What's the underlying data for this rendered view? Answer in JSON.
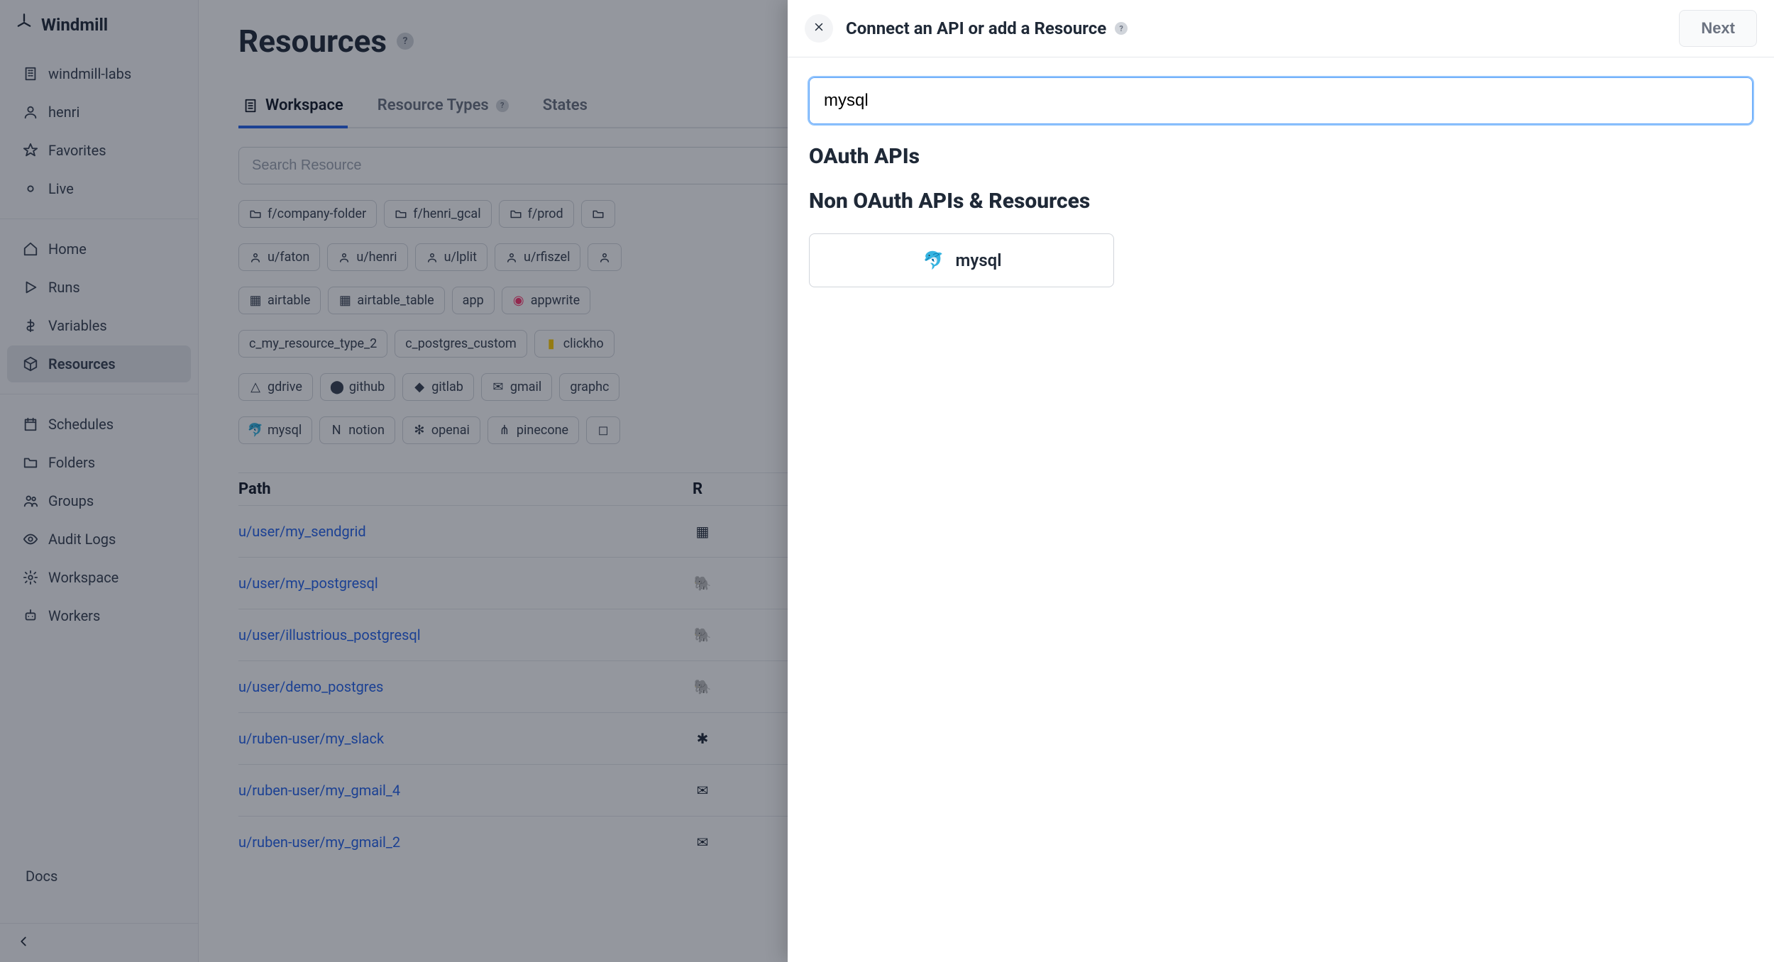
{
  "brand": "Windmill",
  "sidebar": {
    "top": [
      {
        "label": "windmill-labs",
        "icon": "building"
      },
      {
        "label": "henri",
        "icon": "user"
      },
      {
        "label": "Favorites",
        "icon": "star"
      },
      {
        "label": "Live",
        "icon": "dot"
      }
    ],
    "nav": [
      {
        "label": "Home",
        "icon": "home"
      },
      {
        "label": "Runs",
        "icon": "play"
      },
      {
        "label": "Variables",
        "icon": "dollar"
      },
      {
        "label": "Resources",
        "icon": "cube",
        "active": true
      }
    ],
    "manage": [
      {
        "label": "Schedules",
        "icon": "calendar"
      },
      {
        "label": "Folders",
        "icon": "folder"
      },
      {
        "label": "Groups",
        "icon": "users"
      },
      {
        "label": "Audit Logs",
        "icon": "eye"
      },
      {
        "label": "Workspace",
        "icon": "gear"
      },
      {
        "label": "Workers",
        "icon": "robot"
      }
    ],
    "docs": "Docs"
  },
  "page": {
    "title": "Resources",
    "tabs": [
      {
        "label": "Workspace",
        "icon": "building",
        "active": true
      },
      {
        "label": "Resource Types",
        "info": true
      },
      {
        "label": "States"
      }
    ],
    "search_placeholder": "Search Resource",
    "folder_chips": [
      "f/company-folder",
      "f/henri_gcal",
      "f/prod"
    ],
    "user_chips": [
      "u/faton",
      "u/henri",
      "u/lplit",
      "u/rfiszel"
    ],
    "type_chips_row1": [
      "airtable",
      "airtable_table",
      "app",
      "appwrite"
    ],
    "type_chips_row2": [
      "c_my_resource_type_2",
      "c_postgres_custom",
      "clickho"
    ],
    "type_chips_row3": [
      "gdrive",
      "github",
      "gitlab",
      "gmail",
      "graphc"
    ],
    "type_chips_row4": [
      "mysql",
      "notion",
      "openai",
      "pinecone"
    ],
    "table": {
      "headers": {
        "path": "Path",
        "type": "R"
      },
      "rows": [
        {
          "path": "u/user/my_sendgrid"
        },
        {
          "path": "u/user/my_postgresql"
        },
        {
          "path": "u/user/illustrious_postgresql"
        },
        {
          "path": "u/user/demo_postgres"
        },
        {
          "path": "u/ruben-user/my_slack"
        },
        {
          "path": "u/ruben-user/my_gmail_4"
        },
        {
          "path": "u/ruben-user/my_gmail_2"
        }
      ]
    }
  },
  "drawer": {
    "title": "Connect an API or add a Resource",
    "next_label": "Next",
    "search_value": "mysql",
    "section_oauth": "OAuth APIs",
    "section_non_oauth": "Non OAuth APIs & Resources",
    "result": {
      "label": "mysql"
    }
  }
}
